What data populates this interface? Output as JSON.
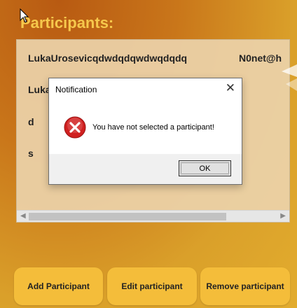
{
  "page_title": "Participants:",
  "participants": [
    {
      "name": "LukaUrosevicqdwdqdqwdwqdqdq",
      "email": "N0net@h"
    },
    {
      "name": "Luka"
    },
    {
      "name": "d"
    },
    {
      "name": "s"
    }
  ],
  "buttons": {
    "add": "Add Participant",
    "edit": "Edit participant",
    "remove": "Remove participant"
  },
  "dialog": {
    "title": "Notification",
    "close": "✕",
    "message": "You have not selected a participant!",
    "ok": "OK",
    "icon": "error-icon"
  },
  "colors": {
    "title": "#f6c84c",
    "button": "#f4bd3a",
    "error": "#d02020"
  }
}
